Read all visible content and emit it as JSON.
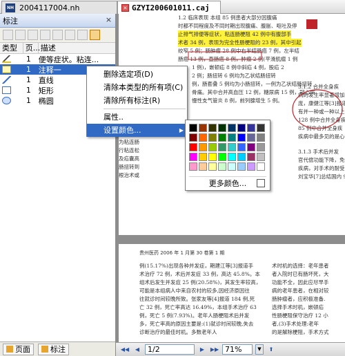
{
  "tabs": [
    {
      "label": "2004117004.nh",
      "icon": "nh-doc-icon"
    },
    {
      "label": "GZYI200601011.caj",
      "icon": "caj-doc-icon"
    }
  ],
  "panel": {
    "title": "标注",
    "columns": [
      "类型",
      "页...",
      "描述"
    ],
    "rows": [
      {
        "icon": "highlighter-icon",
        "page": "1",
        "desc": "便等症状。粘连..."
      },
      {
        "icon": "note-icon",
        "page": "1",
        "desc": "注释一"
      },
      {
        "icon": "line-icon",
        "page": "1",
        "desc": "直线"
      },
      {
        "icon": "rectangle-icon",
        "page": "1",
        "desc": "矩形"
      },
      {
        "icon": "ellipse-icon",
        "page": "1",
        "desc": "椭圆"
      }
    ],
    "bottom_tabs": [
      "页面",
      "标注"
    ]
  },
  "context_menu": {
    "items": [
      "删除选定项(D)",
      "清除本类型的所有项(C)",
      "清除所有标注(R)",
      "属性..",
      "设置颜色..."
    ]
  },
  "color_menu": {
    "swatches": [
      "#000000",
      "#993300",
      "#333300",
      "#003300",
      "#003366",
      "#000080",
      "#333399",
      "#333333",
      "#800000",
      "#ff6600",
      "#808000",
      "#008000",
      "#008080",
      "#0000ff",
      "#666699",
      "#808080",
      "#ff0000",
      "#ff9900",
      "#99cc00",
      "#339966",
      "#33cccc",
      "#3366ff",
      "#800080",
      "#999999",
      "#ff00ff",
      "#ffcc00",
      "#ffff00",
      "#00ff00",
      "#00ffff",
      "#00ccff",
      "#993366",
      "#c0c0c0",
      "#ff99cc",
      "#ffcc99",
      "#ffff99",
      "#ccffcc",
      "#ccffff",
      "#99ccff",
      "#cc99ff",
      "#ffffff"
    ],
    "more_label": "更多颜色..."
  },
  "document": {
    "page1_lines": [
      "1.2  临床表现  本组 85 例患者大部分因腹痛",
      "时都不同程度及不同时期出现腹痛、腹胀、呕吐及停",
      "止排气排便等症状，粘连肠梗阻 42 例中有腹部手",
      "术者 34 例，表现为完全性肠梗阻的 23 例，其中引起",
      "绞窄 5 例；肠肿瘤 28 例中右半结肠癌 7 例，左半结",
      "肠癌 13 例，直肠癌 8 例，肿瘤 2 例(平滑肌瘤 1 例",
      "1 例)，嵌顿疝 8 例中斜疝 4 例，股疝 2",
      "2 例；肠扭转 6 例均为乙状结肠扭转",
      "例，肠套叠 5 例均为小肠扭转，一例为乙状结肠扭转",
      "骨痛。其中合并高血压 12 例，糖尿病 15 例，冠心病",
      "慢性支气管炎 8 例，前列腺增生 5 例。"
    ],
    "page1_left_fragments": [
      "为粘连肠",
      "行粘连松",
      "及疝囊高",
      "肠扭转到",
      "根治术或"
    ],
    "page1_right_lines": [
      "3.1.2  合并全身疾",
      "病的发生率显著增加",
      "庞，康健江等[3]报道",
      "有并一种或一种以上",
      "128 例中合并全身疾",
      "85 例中合并全身疾",
      "疾病中最多见的是心",
      "3.1.3  手术后并发",
      "官代偿功能下降，免",
      "疾病，对手术的耐受",
      "刘宝华[7]总结国内 9"
    ],
    "page2_header": "贵州医药 2006 年 1 月第 30 卷第 1 期",
    "page2_lines": [
      "例(15.17%)出现各种并发症，期建江等[3]报道手",
      "术治疗 72 例，术后并发症 33 例，高达 45.8%。本",
      "组术后发生并发症 25 例(20.58%)，其发生率较高，",
      "可能是本组病人中来自农村的较多,因经济原因往",
      "往就诊时间较晚所致。张家友等[4]报道 184 例,死",
      "亡 32 例，死亡率高达 16.49%，本组手术治疗 63",
      "例，死亡 5 例(7.93%)。老年人肠梗阻术后并发",
      "多，死亡率高的原因主要是:(1)就诊时间较晚,失去",
      "诊断治疗的最佳时机。多数老年人"
    ],
    "page2_right_lines": [
      "术时机的选择：老年患者",
      "者入院时已有肠坏死，大",
      "功能不全，因此应尽早手",
      "病的老年患者，在相对较",
      "肠肿瘤者，应积极准备.",
      "选择手术时机，嵌顿疝",
      "性肠梗阻保守治疗 12 小",
      "者,(3)手术处理:老年",
      "的是解除梗阻，手术方式"
    ]
  },
  "statusbar": {
    "page": "1/2",
    "zoom": "71%"
  }
}
